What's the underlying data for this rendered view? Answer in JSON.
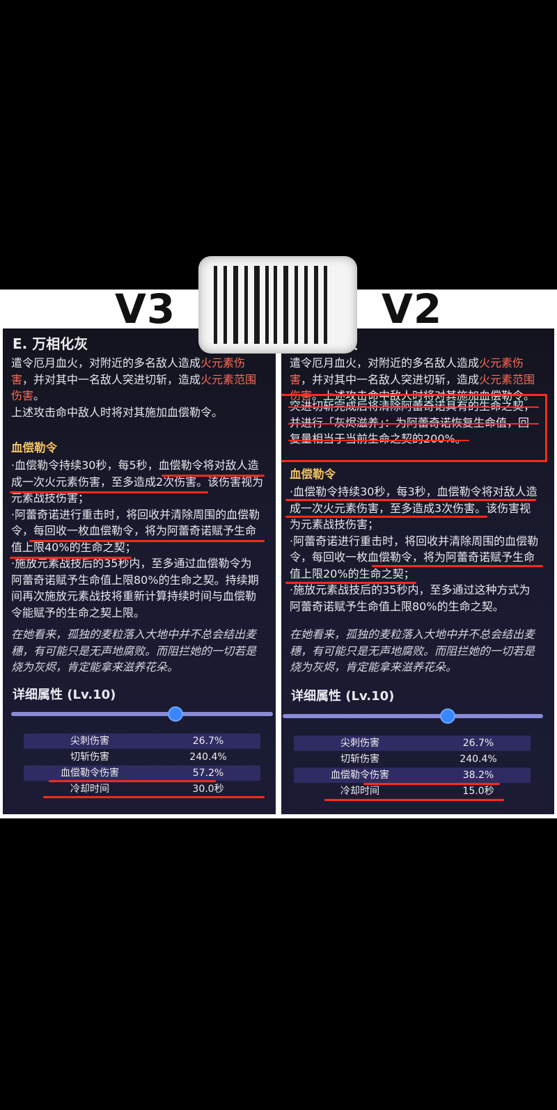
{
  "labels": {
    "left_version": "V3",
    "right_version": "V2"
  },
  "left": {
    "title": "E. 万相化灰",
    "desc_lines": [
      [
        "遣令厄月血火，对附近的多名敌人造成",
        "火元素伤"
      ],
      [
        "害",
        "，并对其中一名敌人突进切斩，造成",
        "火元素范围"
      ],
      [
        "伤害",
        "。"
      ],
      [
        "上述攻击命中敌人时将对其施加血偿勒令。"
      ]
    ],
    "section_title": "血偿勒令",
    "body_lines": [
      "·血偿勒令持续30秒，每5秒，血偿勒令将对敌人造",
      "成一次火元素伤害，至多造成2次伤害。该伤害视为",
      "元素战技伤害；",
      "·阿蕾奇诺进行重击时，将回收并清除周围的血偿勒",
      "令，每回收一枚血偿勒令，将为阿蕾奇诺赋予生命",
      "值上限40%的生命之契；",
      "·施放元素战技后的35秒内，至多通过血偿勒令为",
      "阿蕾奇诺赋予生命值上限80%的生命之契。持续期",
      "间再次施放元素战技将重新计算持续时间与血偿勒",
      "令能赋予的生命之契上限。"
    ],
    "flavor_lines": [
      "在她看来，孤独的麦粒落入大地中并不总会结出麦",
      "穗，有可能只是无声地腐败。而阻拦她的一切若是",
      "烧为灰烬，肯定能拿来滋养花朵。"
    ],
    "attr_title": "详细属性 (Lv.10)",
    "level_fraction": 0.64,
    "stats": [
      {
        "name": "尖刺伤害",
        "value": "26.7%"
      },
      {
        "name": "切斩伤害",
        "value": "240.4%"
      },
      {
        "name": "血偿勒令伤害",
        "value": "57.2%"
      },
      {
        "name": "冷却时间",
        "value": "30.0秒"
      }
    ]
  },
  "right": {
    "title_tail": "灰",
    "desc_lines": [
      [
        "遣令厄月血火，对附近的多名敌人造成",
        "火元素伤"
      ],
      [
        "害",
        "，并对其中一名敌人突进切斩，造成",
        "火元素范围"
      ],
      [
        "伤害",
        "。上述攻击命中敌人时将对其施加血偿勒令。"
      ]
    ],
    "box_lines": [
      "突进切斩完成后将清除阿蕾奇诺具有的生命之契，",
      "并进行「灰烬滋养」：为阿蕾奇诺恢复生命值，回",
      "复量相当于当前生命之契的200%。"
    ],
    "section_title": "血偿勒令",
    "body_lines": [
      "·血偿勒令持续30秒，每3秒，血偿勒令将对敌人造",
      "成一次火元素伤害，至多造成3次伤害。该伤害视",
      "为元素战技伤害；",
      "·阿蕾奇诺进行重击时，将回收并清除周围的血偿勒",
      "令，每回收一枚血偿勒令，将为阿蕾奇诺赋予生命",
      "值上限20%的生命之契；",
      "·施放元素战技后的35秒内，至多通过这种方式为",
      "阿蕾奇诺赋予生命值上限80%的生命之契。"
    ],
    "flavor_lines": [
      "在她看来，孤独的麦粒落入大地中并不总会结出麦",
      "穗，有可能只是无声地腐败。而阻拦她的一切若是",
      "烧为灰烬，肯定能拿来滋养花朵。"
    ],
    "attr_title": "详细属性 (Lv.10)",
    "level_fraction": 0.64,
    "stats": [
      {
        "name": "尖刺伤害",
        "value": "26.7%"
      },
      {
        "name": "切斩伤害",
        "value": "240.4%"
      },
      {
        "name": "血偿勒令伤害",
        "value": "38.2%"
      },
      {
        "name": "冷却时间",
        "value": "15.0秒"
      }
    ]
  }
}
